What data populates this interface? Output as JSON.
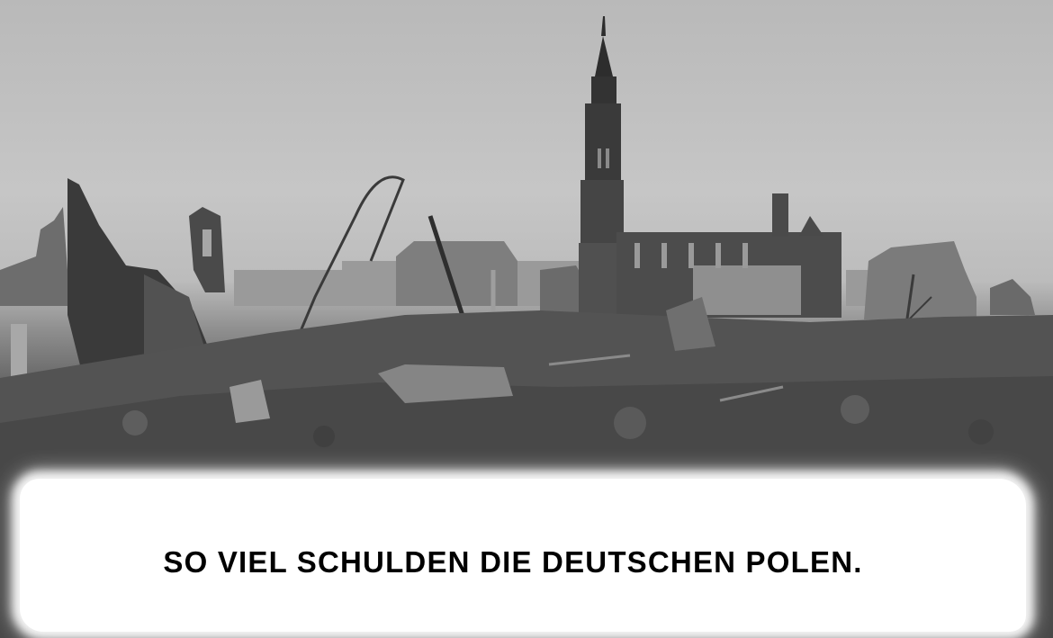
{
  "caption": {
    "text": "SO VIEL SCHULDEN DIE DEUTSCHEN POLEN."
  },
  "photo": {
    "style": "black-and-white",
    "colors": {
      "sky": "#c2c2c2",
      "rubble": "#4d4d4d",
      "caption_background": "#ffffff",
      "caption_text": "#000000"
    }
  }
}
